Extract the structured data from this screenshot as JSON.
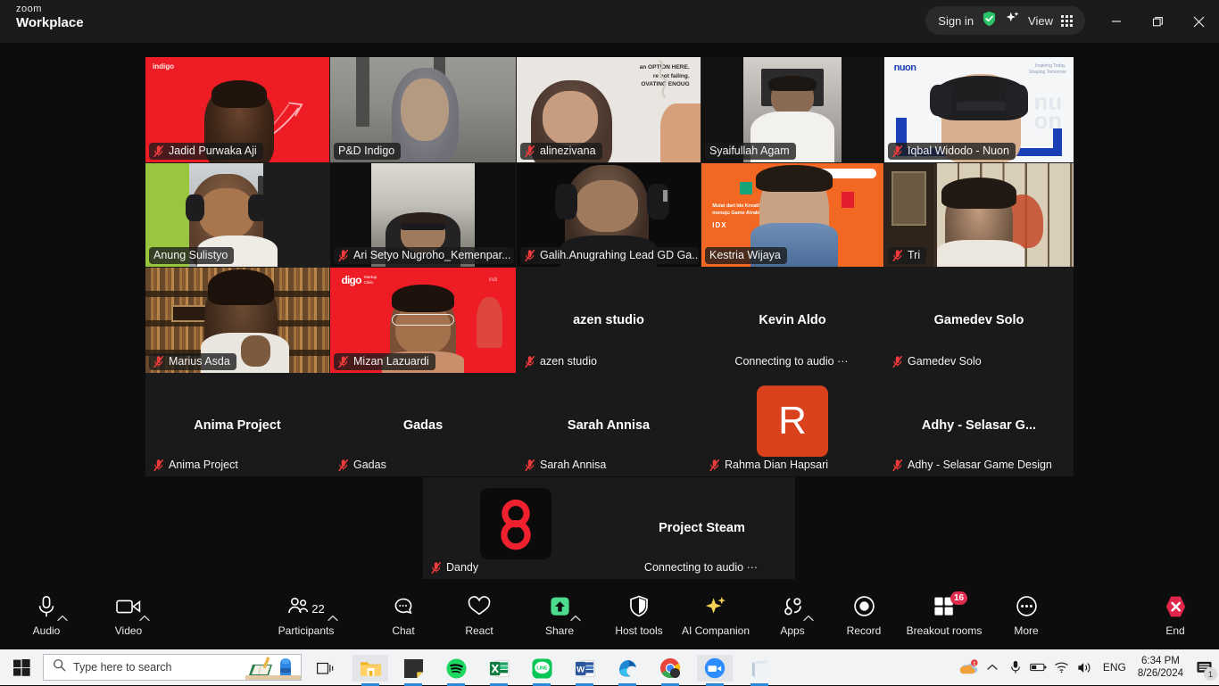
{
  "titlebar": {
    "brand_small": "zoom",
    "brand_big": "Workplace",
    "sign_in": "Sign in",
    "view": "View",
    "shield_icon": "shield-check-icon",
    "sparkle_icon": "ai-sparkle-icon",
    "grid_icon": "view-grid-icon",
    "minimize_icon": "minimize-icon",
    "maximize_icon": "restore-icon",
    "close_icon": "close-icon"
  },
  "gallery": {
    "rows": [
      [
        {
          "name": "Jadid Purwaka Aji",
          "video": true,
          "muted": true,
          "active": false,
          "bg": "indigo-red"
        },
        {
          "name": "P&D Indigo",
          "video": true,
          "muted": false,
          "active": true,
          "bg": "room-gray"
        },
        {
          "name": "alinezivana",
          "video": true,
          "muted": true,
          "active": false,
          "bg": "wall-quote"
        },
        {
          "name": "Syaifullah Agam",
          "video": true,
          "muted": false,
          "active": false,
          "bg": "office-dark"
        },
        {
          "name": "Iqbal Widodo - Nuon",
          "video": true,
          "muted": true,
          "active": false,
          "bg": "nuon-white"
        }
      ],
      [
        {
          "name": "Anung Sulistyo",
          "video": true,
          "muted": false,
          "active": false,
          "bg": "green-wall"
        },
        {
          "name": "Ari Setyo Nugroho_Kemenpar...",
          "video": true,
          "muted": true,
          "active": false,
          "bg": "ceiling-room"
        },
        {
          "name": "Galih.Anugrahing Lead GD Ga...",
          "video": true,
          "muted": true,
          "active": false,
          "bg": "dark-room"
        },
        {
          "name": "Kestria Wijaya",
          "video": true,
          "muted": false,
          "active": false,
          "bg": "idx-orange"
        },
        {
          "name": "Tri",
          "video": true,
          "muted": true,
          "active": false,
          "bg": "japan-room"
        }
      ],
      [
        {
          "name": "Marius Asda",
          "video": true,
          "muted": true,
          "active": false,
          "bg": "library"
        },
        {
          "name": "Mizan Lazuardi",
          "video": true,
          "muted": true,
          "active": false,
          "bg": "indigo-startup-red"
        },
        {
          "name": "azen studio",
          "display": "azen studio",
          "video": false,
          "muted": true,
          "active": false
        },
        {
          "name": "Connecting to audio ···",
          "display": "Kevin Aldo",
          "video": false,
          "muted": false,
          "active": false,
          "connecting": true
        },
        {
          "name": "Gamedev Solo",
          "display": "Gamedev Solo",
          "video": false,
          "muted": true,
          "active": false
        }
      ],
      [
        {
          "name": "Anima Project",
          "display": "Anima Project",
          "video": false,
          "muted": true,
          "active": false
        },
        {
          "name": "Gadas",
          "display": "Gadas",
          "video": false,
          "muted": true,
          "active": false
        },
        {
          "name": "Sarah Annisa",
          "display": "Sarah Annisa",
          "video": false,
          "muted": true,
          "active": false
        },
        {
          "name": "Rahma Dian Hapsari",
          "avatar_letter": "R",
          "avatar_color": "#d9421c",
          "video": false,
          "muted": true,
          "active": false
        },
        {
          "name": "Adhy - Selasar Game Design",
          "display": "Adhy - Selasar G...",
          "video": false,
          "muted": true,
          "active": false
        }
      ]
    ],
    "bottom_row": [
      {
        "name": "Dandy",
        "avatar_letter": "g",
        "avatar_color": "#0b0b0b",
        "avatar_glyph_color": "#f0212f",
        "video": false,
        "muted": true
      },
      {
        "name": "Connecting to audio ···",
        "display": "Project Steam",
        "video": false,
        "muted": false,
        "connecting": true
      }
    ]
  },
  "toolbar": {
    "items": [
      {
        "label": "Audio",
        "icon": "microphone-icon",
        "caret": true
      },
      {
        "label": "Video",
        "icon": "camera-icon",
        "caret": true
      },
      {
        "label": "Participants",
        "icon": "participants-icon",
        "caret": true,
        "count": "22"
      },
      {
        "label": "Chat",
        "icon": "chat-bubble-icon",
        "caret": false
      },
      {
        "label": "React",
        "icon": "heart-icon",
        "caret": false
      },
      {
        "label": "Share",
        "icon": "share-screen-icon",
        "caret": true
      },
      {
        "label": "Host tools",
        "icon": "shield-icon",
        "caret": false
      },
      {
        "label": "AI Companion",
        "icon": "ai-sparkle-icon",
        "caret": false
      },
      {
        "label": "Apps",
        "icon": "apps-icon",
        "caret": true
      },
      {
        "label": "Record",
        "icon": "record-icon",
        "caret": false
      },
      {
        "label": "Breakout rooms",
        "icon": "breakout-rooms-icon",
        "caret": false,
        "badge": "16"
      },
      {
        "label": "More",
        "icon": "more-dots-icon",
        "caret": false
      },
      {
        "label": "End",
        "icon": "end-call-icon",
        "caret": false
      }
    ],
    "accent_green": "#4ddb8e",
    "accent_yellow": "#f7d257",
    "end_red": "#e0274b",
    "badge_red": "#e02d4e"
  },
  "taskbar": {
    "start_icon": "windows-start-icon",
    "search_placeholder": "Type here to search",
    "search_icon": "search-icon",
    "taskview_icon": "task-view-icon",
    "apps": [
      {
        "icon": "file-explorer-icon"
      },
      {
        "icon": "sticky-notes-icon"
      },
      {
        "icon": "spotify-icon"
      },
      {
        "icon": "excel-icon"
      },
      {
        "icon": "line-icon"
      },
      {
        "icon": "word-icon"
      },
      {
        "icon": "edge-icon"
      },
      {
        "icon": "chrome-icon"
      },
      {
        "icon": "zoom-icon"
      },
      {
        "icon": "notepad-icon"
      }
    ],
    "tray": {
      "onedrive_icon": "onedrive-alert-icon",
      "chevron_icon": "show-hidden-icons-icon",
      "mic_icon": "microphone-icon",
      "battery_icon": "battery-icon",
      "wifi_icon": "wifi-icon",
      "volume_icon": "volume-icon",
      "language": "ENG",
      "time": "6:34 PM",
      "date": "8/26/2024",
      "notification_icon": "notification-center-icon",
      "notification_count": "1"
    }
  }
}
